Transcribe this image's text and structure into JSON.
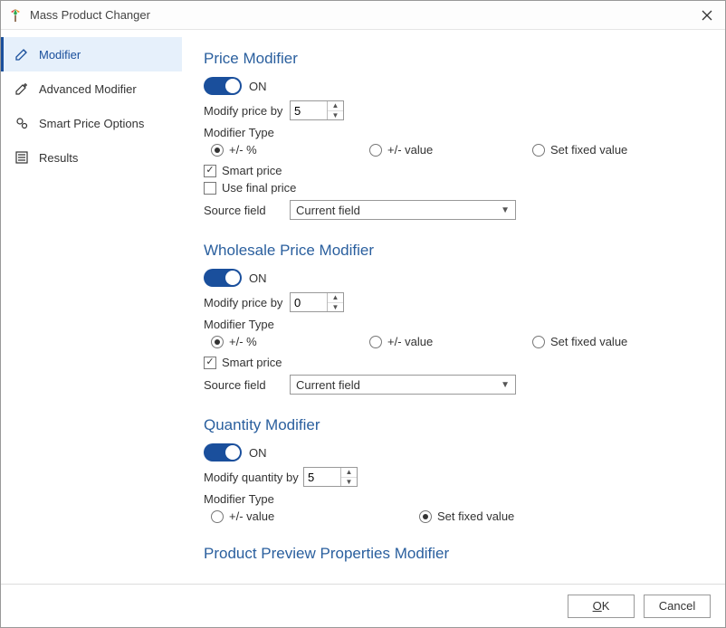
{
  "window": {
    "title": "Mass Product Changer"
  },
  "sidebar": {
    "items": [
      {
        "label": "Modifier"
      },
      {
        "label": "Advanced Modifier"
      },
      {
        "label": "Smart Price Options"
      },
      {
        "label": "Results"
      }
    ]
  },
  "sections": {
    "price": {
      "title": "Price Modifier",
      "toggle": "ON",
      "modify_label": "Modify price by",
      "modify_value": "5",
      "modifier_type_label": "Modifier Type",
      "radios": {
        "pct": "+/- %",
        "val": "+/- value",
        "fixed": "Set fixed value"
      },
      "smart_price": "Smart price",
      "use_final": "Use final price",
      "source_label": "Source field",
      "source_value": "Current field"
    },
    "wholesale": {
      "title": "Wholesale Price Modifier",
      "toggle": "ON",
      "modify_label": "Modify price by",
      "modify_value": "0",
      "modifier_type_label": "Modifier Type",
      "radios": {
        "pct": "+/- %",
        "val": "+/- value",
        "fixed": "Set fixed value"
      },
      "smart_price": "Smart price",
      "source_label": "Source field",
      "source_value": "Current field"
    },
    "quantity": {
      "title": "Quantity Modifier",
      "toggle": "ON",
      "modify_label": "Modify quantity by",
      "modify_value": "5",
      "modifier_type_label": "Modifier Type",
      "radios": {
        "val": "+/- value",
        "fixed": "Set fixed value"
      }
    },
    "preview": {
      "title": "Product Preview Properties Modifier"
    }
  },
  "footer": {
    "ok": "OK",
    "cancel": "Cancel"
  }
}
